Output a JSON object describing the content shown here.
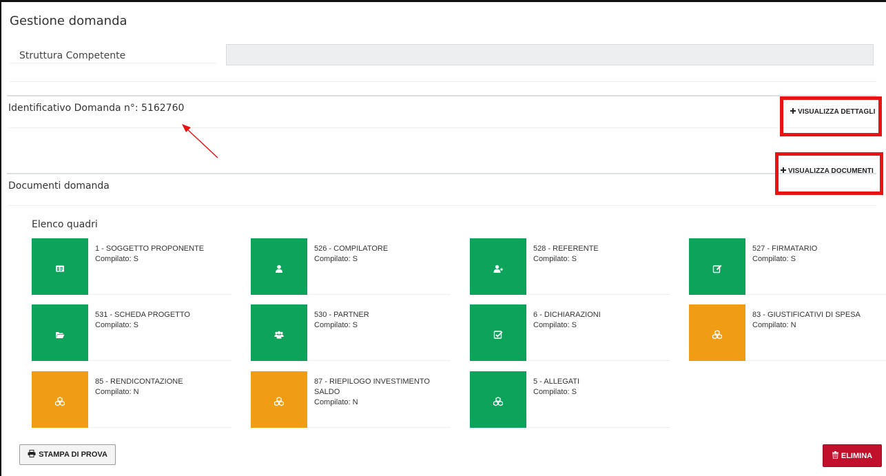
{
  "page": {
    "title": "Gestione domanda"
  },
  "struttura": {
    "label": "Struttura Competente",
    "value": ""
  },
  "identificativo": {
    "label": "Identificativo Domanda n°: 5162760",
    "action": "VISUALIZZA DETTAGLI"
  },
  "documenti": {
    "label": "Documenti domanda",
    "action": "VISUALIZZA DOCUMENTI"
  },
  "elenco": {
    "title": "Elenco quadri",
    "quadri": [
      {
        "name": "1 - SOGGETTO PROPONENTE",
        "status": "Compilato: S",
        "color": "#0da35b",
        "icon": "id-card-icon"
      },
      {
        "name": "526 - COMPILATORE",
        "status": "Compilato: S",
        "color": "#0da35b",
        "icon": "user-icon"
      },
      {
        "name": "528 - REFERENTE",
        "status": "Compilato: S",
        "color": "#0da35b",
        "icon": "user-plus-icon"
      },
      {
        "name": "527 - FIRMATARIO",
        "status": "Compilato: S",
        "color": "#0da35b",
        "icon": "edit-icon"
      },
      {
        "name": "531 - SCHEDA PROGETTO",
        "status": "Compilato: S",
        "color": "#0da35b",
        "icon": "folder-open-icon"
      },
      {
        "name": "530 - PARTNER",
        "status": "Compilato: S",
        "color": "#0da35b",
        "icon": "users-icon"
      },
      {
        "name": "6 - DICHIARAZIONI",
        "status": "Compilato: S",
        "color": "#0da35b",
        "icon": "check-square-icon"
      },
      {
        "name": "83 - GIUSTIFICATIVI DI SPESA",
        "status": "Compilato: N",
        "color": "#f19c15",
        "icon": "cubes-icon"
      },
      {
        "name": "85 - RENDICONTAZIONE",
        "status": "Compilato: N",
        "color": "#f19c15",
        "icon": "cubes-icon"
      },
      {
        "name": "87 - RIEPILOGO INVESTIMENTO SALDO",
        "status": "Compilato: N",
        "color": "#f19c15",
        "icon": "cubes-icon"
      },
      {
        "name": "5 - ALLEGATI",
        "status": "Compilato: S",
        "color": "#0da35b",
        "icon": "cubes-icon"
      }
    ]
  },
  "footer": {
    "stampa_label": "STAMPA DI PROVA",
    "elimina_label": "ELIMINA"
  },
  "colors": {
    "green": "#0da35b",
    "orange": "#f19c15",
    "danger": "#c0102b",
    "highlight": "#e81414"
  }
}
